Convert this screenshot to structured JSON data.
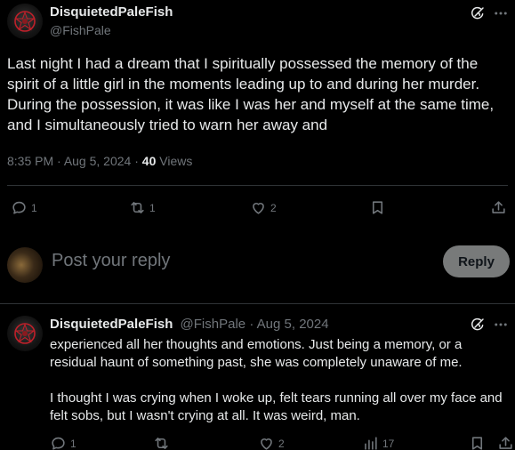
{
  "post": {
    "author_name": "DisquietedPaleFish",
    "author_handle": "@FishPale",
    "text": "Last night I had a dream that I spiritually possessed the memory of the spirit of a little girl in the moments leading up to and during her murder. During the possession, it was like I was her and myself at the same time, and I simultaneously tried to warn her away and",
    "time": "8:35 PM",
    "date": "Aug 5, 2024",
    "views_count": "40",
    "views_label": "Views",
    "replies": "1",
    "reposts": "1",
    "likes": "2"
  },
  "composer": {
    "placeholder": "Post your reply",
    "button_label": "Reply"
  },
  "reply": {
    "author_name": "DisquietedPaleFish",
    "author_handle": "@FishPale",
    "date": "Aug 5, 2024",
    "paragraph_1": "experienced all her thoughts and emotions.  Just being a memory, or a residual haunt of something past, she was completely unaware of me.",
    "paragraph_2": "I thought I was crying when I woke up, felt tears running all over my face and felt sobs, but I wasn't crying at all.  It was weird, man.",
    "replies": "1",
    "likes": "2",
    "views": "17"
  },
  "colors": {
    "background": "#000000",
    "text_primary": "#e7e9ea",
    "text_secondary": "#71767b",
    "divider": "#2f3336",
    "reply_button_bg": "#787a7a"
  },
  "icons": [
    "grok-icon",
    "more-icon",
    "reply-icon",
    "repost-icon",
    "like-icon",
    "bookmark-icon",
    "share-icon",
    "views-icon"
  ]
}
